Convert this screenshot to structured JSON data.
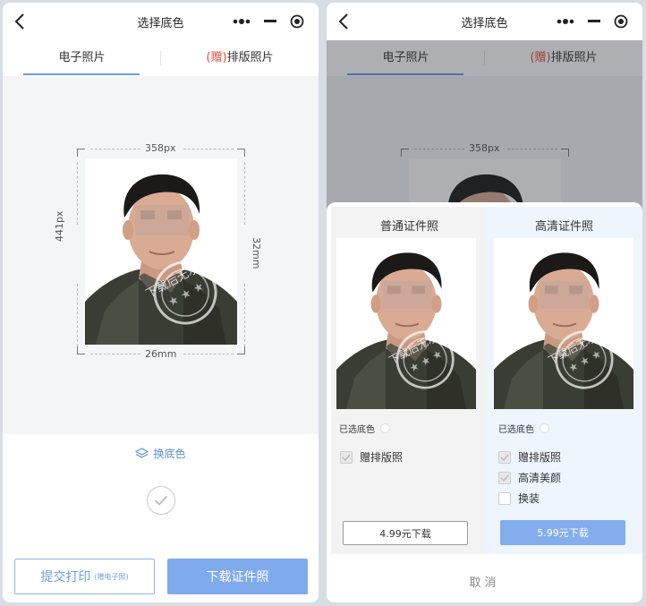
{
  "nav": {
    "title": "选择底色"
  },
  "tabs": {
    "electronic": "电子照片",
    "gift": "(赠)",
    "layout": "排版照片"
  },
  "preview": {
    "width_px": "358px",
    "height_px": "441px",
    "height_mm": "32mm",
    "width_mm": "26mm",
    "watermark": "下载后无水印"
  },
  "actions": {
    "change_bg": "换底色",
    "print_label": "提交打印",
    "print_sub": "(赠电子照)",
    "download_label": "下载证件照"
  },
  "sheet": {
    "normal": {
      "title": "普通证件照",
      "selected_bg": "已选底色",
      "opt1": "赠排版照",
      "price_button": "4.99元下载"
    },
    "hd": {
      "title": "高清证件照",
      "selected_bg": "已选底色",
      "opt1": "赠排版照",
      "opt2": "高清美颜",
      "opt3": "换装",
      "price_button": "5.99元下载"
    },
    "cancel": "取消"
  },
  "colors": {
    "accent": "#6b9ee8",
    "primary_button": "#7faaee",
    "gift": "#e84a3c"
  },
  "icons": [
    "back-icon",
    "more-dots-icon",
    "minimize-icon",
    "close-target-icon",
    "layers-icon",
    "check-icon"
  ]
}
